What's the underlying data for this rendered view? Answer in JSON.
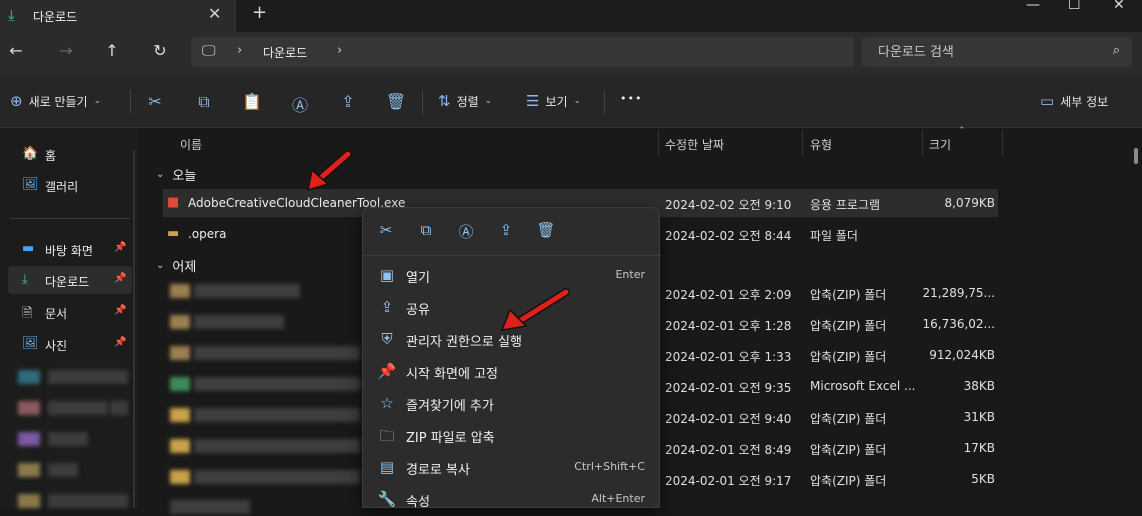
{
  "tab": {
    "icon": "download-icon",
    "title": "다운로드",
    "close": "✕",
    "new": "+"
  },
  "window": {
    "minimize": "—",
    "maximize": "☐",
    "close": "✕"
  },
  "nav": {
    "back": "←",
    "forward": "→",
    "up": "↑",
    "refresh": "↻"
  },
  "address": {
    "pc_icon": "🖵",
    "separator": "›",
    "crumb": "다운로드"
  },
  "search": {
    "placeholder": "다운로드 검색",
    "icon": "⌕"
  },
  "commandbar": {
    "new_label": "새로 만들기",
    "new_icon": "⊕",
    "sort_label": "정렬",
    "sort_icon": "⇅",
    "view_label": "보기",
    "view_icon": "☰",
    "more": "•••",
    "details_label": "세부 정보",
    "details_icon": "▭",
    "chev": "⌄",
    "icons": {
      "cut": "✂",
      "copy": "⧉",
      "paste": "📋",
      "rename": "Ⓐ",
      "share": "⇪",
      "delete": "🗑"
    }
  },
  "sidebar": {
    "items": [
      {
        "label": "홈",
        "icon": "🏠",
        "pinned": false
      },
      {
        "label": "갤러리",
        "icon": "🖼",
        "pinned": false
      },
      {
        "label": "바탕 화면",
        "icon": "▬",
        "pinned": true
      },
      {
        "label": "다운로드",
        "icon": "⤓",
        "pinned": true
      },
      {
        "label": "문서",
        "icon": "🗎",
        "pinned": true
      },
      {
        "label": "사진",
        "icon": "🖼",
        "pinned": true
      }
    ],
    "pin_icon": "📌"
  },
  "columns": {
    "name": "이름",
    "date": "수정한 날짜",
    "type": "유형",
    "size": "크기",
    "sort_chev": "⌃"
  },
  "groups": {
    "today": "오늘",
    "yesterday": "어제",
    "chev": "⌄"
  },
  "files_today": [
    {
      "name": "AdobeCreativeCloudCleanerTool.exe",
      "date": "2024-02-02 오전 9:10",
      "type": "응용 프로그램",
      "size": "8,079KB",
      "icon": "application-icon"
    },
    {
      "name": ".opera",
      "date": "2024-02-02 오전 8:44",
      "type": "파일 폴더",
      "size": "",
      "icon": "folder-icon"
    }
  ],
  "files_yesterday": [
    {
      "date": "2024-02-01 오후 2:09",
      "type": "압축(ZIP) 폴더",
      "size": "21,289,75..."
    },
    {
      "date": "2024-02-01 오후 1:28",
      "type": "압축(ZIP) 폴더",
      "size": "16,736,02..."
    },
    {
      "date": "2024-02-01 오후 1:33",
      "type": "압축(ZIP) 폴더",
      "size": "912,024KB"
    },
    {
      "date": "2024-02-01 오전 9:35",
      "type": "Microsoft Excel ...",
      "size": "38KB"
    },
    {
      "date": "2024-02-01 오전 9:40",
      "type": "압축(ZIP) 폴더",
      "size": "31KB"
    },
    {
      "date": "2024-02-01 오전 8:49",
      "type": "압축(ZIP) 폴더",
      "size": "17KB"
    },
    {
      "date": "2024-02-01 오전 9:17",
      "type": "압축(ZIP) 폴더",
      "size": "5KB"
    }
  ],
  "context_menu": {
    "toolbar": {
      "cut": "✂",
      "copy": "⧉",
      "rename": "Ⓐ",
      "share": "⇪",
      "delete": "🗑"
    },
    "items": [
      {
        "label": "열기",
        "shortcut": "Enter",
        "icon": "▣"
      },
      {
        "label": "공유",
        "shortcut": "",
        "icon": "⇪"
      },
      {
        "label": "관리자 권한으로 실행",
        "shortcut": "",
        "icon": "⛨"
      },
      {
        "label": "시작 화면에 고정",
        "shortcut": "",
        "icon": "📌"
      },
      {
        "label": "즐겨찾기에 추가",
        "shortcut": "",
        "icon": "☆"
      },
      {
        "label": "ZIP 파일로 압축",
        "shortcut": "",
        "icon": "🗀"
      },
      {
        "label": "경로로 복사",
        "shortcut": "Ctrl+Shift+C",
        "icon": "▤"
      },
      {
        "label": "속성",
        "shortcut": "Alt+Enter",
        "icon": "🔧"
      }
    ]
  },
  "colors": {
    "accent": "#8fc4f0",
    "arrow": "#e0201b",
    "background": "#191919",
    "menu": "#2c2c2c"
  }
}
